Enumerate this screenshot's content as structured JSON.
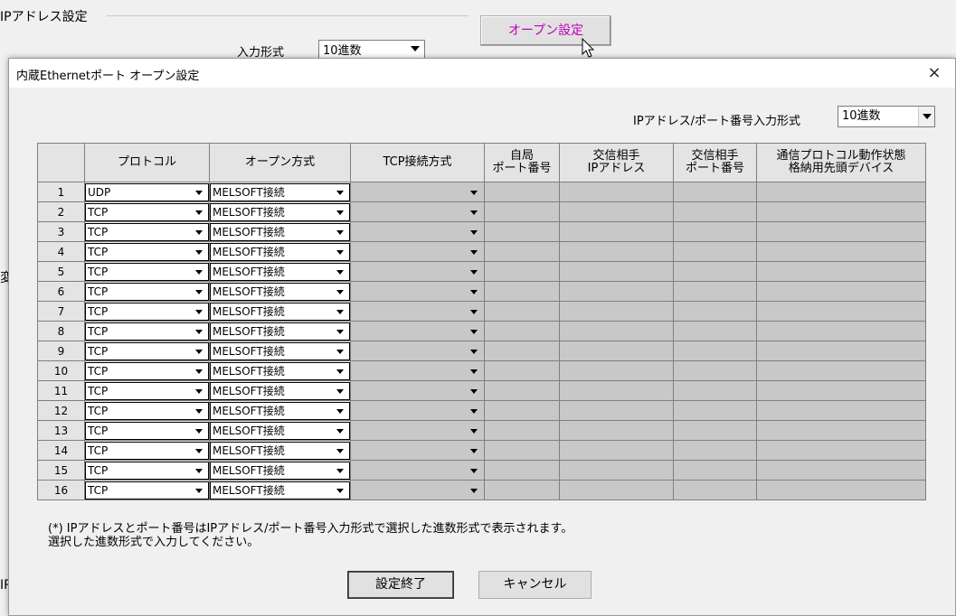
{
  "background": {
    "group_title": "IPアドレス設定",
    "field_label": "入力形式",
    "field_value": "10進数",
    "open_settings_button": "オープン設定",
    "left_fragment_1": "変",
    "left_fragment_2": "IP"
  },
  "dialog": {
    "title": "内蔵Ethernetポート オープン設定",
    "close_glyph": "×",
    "input_format_label": "IPアドレス/ポート番号入力形式",
    "input_format_value": "10進数",
    "headers": {
      "no": "",
      "protocol": "プロトコル",
      "open_method": "オープン方式",
      "tcp_connection": "TCP接続方式",
      "own_port_l1": "自局",
      "own_port_l2": "ポート番号",
      "remote_ip_l1": "交信相手",
      "remote_ip_l2": "IPアドレス",
      "remote_port_l1": "交信相手",
      "remote_port_l2": "ポート番号",
      "status_device_l1": "通信プロトコル動作状態",
      "status_device_l2": "格納用先頭デバイス"
    },
    "rows": [
      {
        "no": "1",
        "protocol": "UDP",
        "open_method": "MELSOFT接続"
      },
      {
        "no": "2",
        "protocol": "TCP",
        "open_method": "MELSOFT接続"
      },
      {
        "no": "3",
        "protocol": "TCP",
        "open_method": "MELSOFT接続"
      },
      {
        "no": "4",
        "protocol": "TCP",
        "open_method": "MELSOFT接続"
      },
      {
        "no": "5",
        "protocol": "TCP",
        "open_method": "MELSOFT接続"
      },
      {
        "no": "6",
        "protocol": "TCP",
        "open_method": "MELSOFT接続"
      },
      {
        "no": "7",
        "protocol": "TCP",
        "open_method": "MELSOFT接続"
      },
      {
        "no": "8",
        "protocol": "TCP",
        "open_method": "MELSOFT接続"
      },
      {
        "no": "9",
        "protocol": "TCP",
        "open_method": "MELSOFT接続"
      },
      {
        "no": "10",
        "protocol": "TCP",
        "open_method": "MELSOFT接続"
      },
      {
        "no": "11",
        "protocol": "TCP",
        "open_method": "MELSOFT接続"
      },
      {
        "no": "12",
        "protocol": "TCP",
        "open_method": "MELSOFT接続"
      },
      {
        "no": "13",
        "protocol": "TCP",
        "open_method": "MELSOFT接続"
      },
      {
        "no": "14",
        "protocol": "TCP",
        "open_method": "MELSOFT接続"
      },
      {
        "no": "15",
        "protocol": "TCP",
        "open_method": "MELSOFT接続"
      },
      {
        "no": "16",
        "protocol": "TCP",
        "open_method": "MELSOFT接続"
      }
    ],
    "note_line1": "(*) IPアドレスとポート番号はIPアドレス/ポート番号入力形式で選択した進数形式で表示されます。",
    "note_line2": "選択した進数形式で入力してください。",
    "ok_button": "設定終了",
    "cancel_button": "キャンセル"
  },
  "colors": {
    "highlight_text": "#c000c0",
    "disabled_cell": "#c8c8c8",
    "header_bg": "#e4e4e4"
  }
}
